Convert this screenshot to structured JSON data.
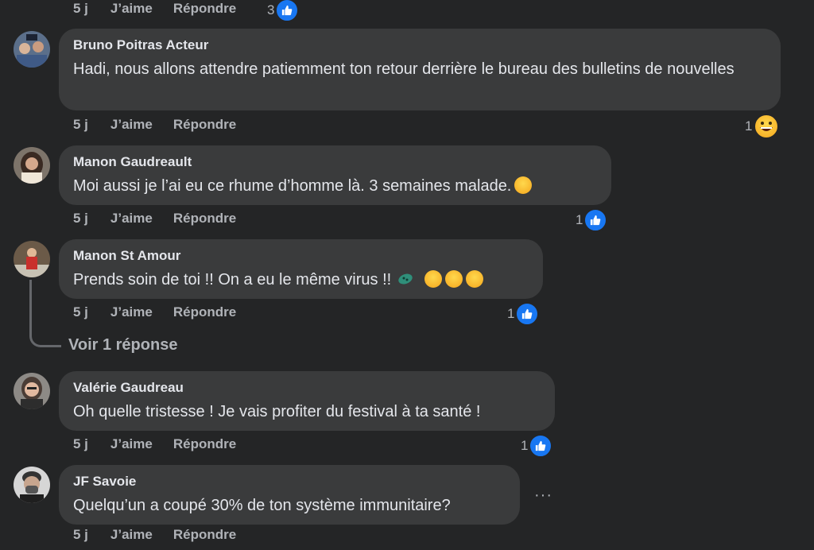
{
  "top_actions": {
    "time": "5 j",
    "like": "J’aime",
    "reply": "Répondre",
    "reaction_count": "3"
  },
  "comments": [
    {
      "author": "Bruno Poitras Acteur",
      "text": "Hadi, nous allons attendre patiemment ton retour derrière le bureau des bulletins de nouvelles",
      "time": "5 j",
      "like": "J’aime",
      "reply": "Répondre",
      "reaction_count": "1",
      "reaction": "grin-emoji"
    },
    {
      "author": "Manon Gaudreault",
      "text": "Moi aussi je l’ai eu ce rhume d’homme là. 3 semaines malade.",
      "time": "5 j",
      "like": "J’aime",
      "reply": "Répondre",
      "reaction_count": "1",
      "reaction": "like"
    },
    {
      "author": "Manon St Amour",
      "text": "Prends soin de toi !! On a eu le même virus !!",
      "time": "5 j",
      "like": "J’aime",
      "reply": "Répondre",
      "reaction_count": "1",
      "reaction": "like"
    },
    {
      "author": "Valérie Gaudreau",
      "text": "Oh quelle tristesse ! Je vais profiter du festival à ta santé !",
      "time": "5 j",
      "like": "J’aime",
      "reply": "Répondre",
      "reaction_count": "1",
      "reaction": "like"
    },
    {
      "author": "JF Savoie",
      "text": "Quelqu’un a coupé 30% de ton système immunitaire?",
      "time": "5 j",
      "like": "J’aime",
      "reply": "Répondre"
    }
  ],
  "view_replies": "Voir 1 réponse",
  "more_menu": "···",
  "colors": {
    "background": "#242526",
    "bubble": "#3a3b3c",
    "like_blue": "#1877f2",
    "secondary_text": "#b0b3b8"
  }
}
